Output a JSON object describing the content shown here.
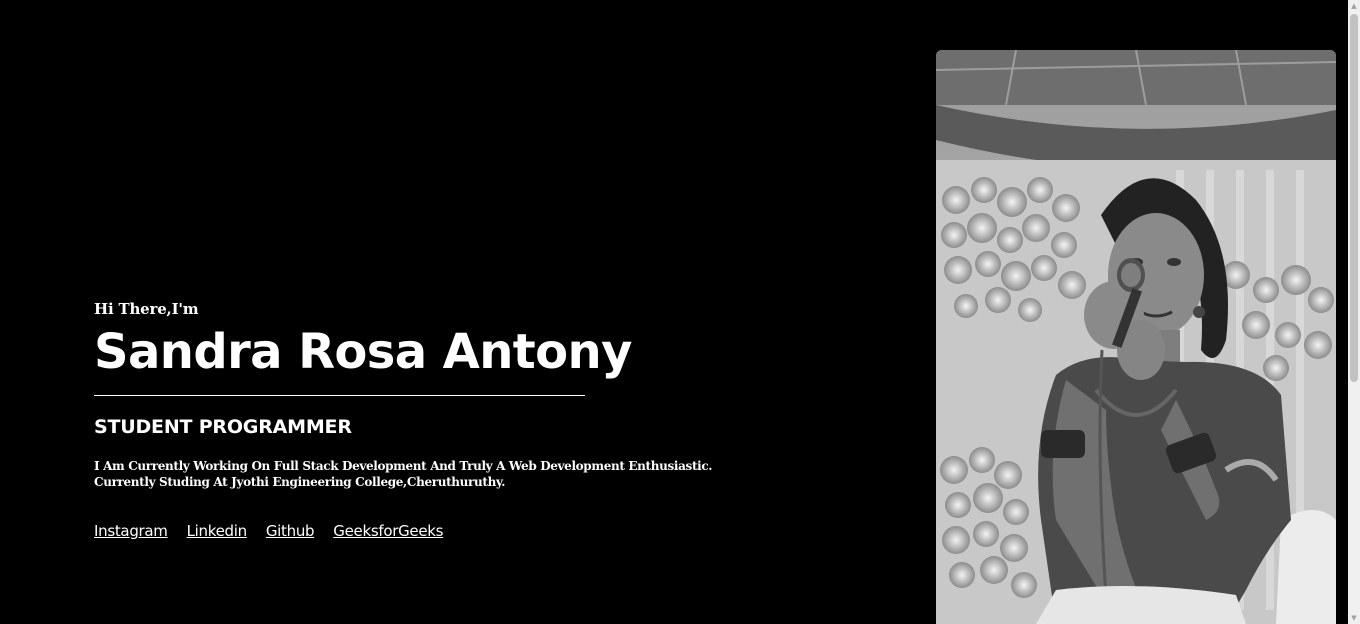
{
  "hero": {
    "greeting": "Hi There,I'm",
    "name": "Sandra Rosa Antony",
    "role": "STUDENT PROGRAMMER",
    "bio_line1": "I Am Currently Working On Full Stack Development And Truly A Web Development Enthusiastic.",
    "bio_line2": "Currently Studing At Jyothi Engineering College,Cheruthuruthy."
  },
  "links": [
    {
      "label": "Instagram"
    },
    {
      "label": "Linkedin"
    },
    {
      "label": "Github"
    },
    {
      "label": "GeeksforGeeks"
    }
  ],
  "photo": {
    "icon": "profile-photo",
    "alt": "Sandra Rosa Antony"
  },
  "colors": {
    "background": "#000000",
    "text": "#ffffff"
  },
  "scrollbar": {
    "up_icon": "arrow-up-icon",
    "down_icon": "arrow-down-icon"
  }
}
